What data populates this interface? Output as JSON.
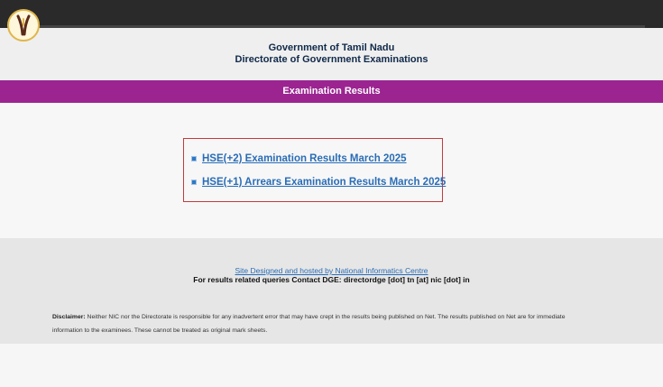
{
  "header": {
    "line1": "Government of Tamil Nadu",
    "line2": "Directorate of Government Examinations"
  },
  "banner": {
    "title": "Examination Results"
  },
  "results": {
    "links": [
      "HSE(+2) Examination Results March 2025",
      "HSE(+1) Arrears Examination Results March 2025"
    ]
  },
  "footer": {
    "site_credit": "Site Designed and hosted by National Informatics Centre",
    "contact": "For results related queries Contact DGE:  directordge [dot] tn [at] nic [dot] in",
    "disclaimer_label": "Disclaimer:",
    "disclaimer_text": " Neither NIC nor the Directorate is responsible for any inadvertent error that may have crept in the results being published on Net. The results published on Net are for immediate information to the examinees. These cannot be treated as original mark sheets."
  },
  "icons": {
    "logo": "tuning-fork-logo-icon",
    "bullet": "square-bullet-icon"
  },
  "colors": {
    "banner": "#9b2491",
    "link": "#2a6db6",
    "box_border": "#c23b3b",
    "header_text": "#10294a"
  }
}
